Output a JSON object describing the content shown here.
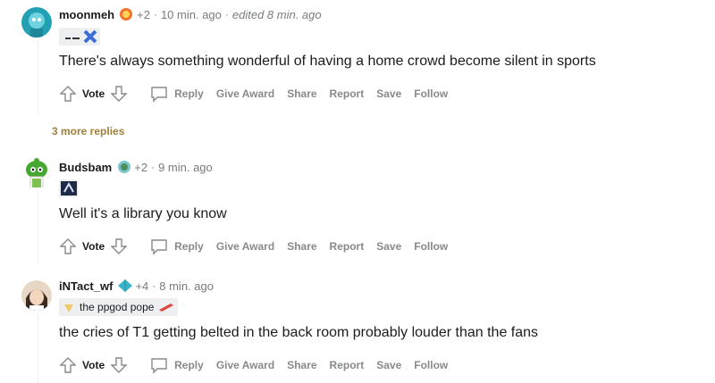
{
  "comments": [
    {
      "author": "moonmeh",
      "score": "+2",
      "time": "10 min. ago",
      "edited": "edited 8 min. ago",
      "flair": "",
      "text": "There's always something wonderful of having a home crowd become silent in sports"
    },
    {
      "author": "Budsbam",
      "score": "+2",
      "time": "9 min. ago",
      "flair": "",
      "text": "Well it's a library you know"
    },
    {
      "author": "iNTact_wf",
      "score": "+4",
      "time": "8 min. ago",
      "flair": "the ppgod pope",
      "text": "the cries of T1 getting belted in the back room probably louder than the fans"
    }
  ],
  "more_replies": "3 more replies",
  "actions": {
    "vote": "Vote",
    "reply": "Reply",
    "give_award": "Give Award",
    "share": "Share",
    "report": "Report",
    "save": "Save",
    "follow": "Follow"
  },
  "colors": {
    "meta_gray": "#787c7e",
    "action_gray": "#878a8c",
    "more_replies": "#a17f3a"
  }
}
